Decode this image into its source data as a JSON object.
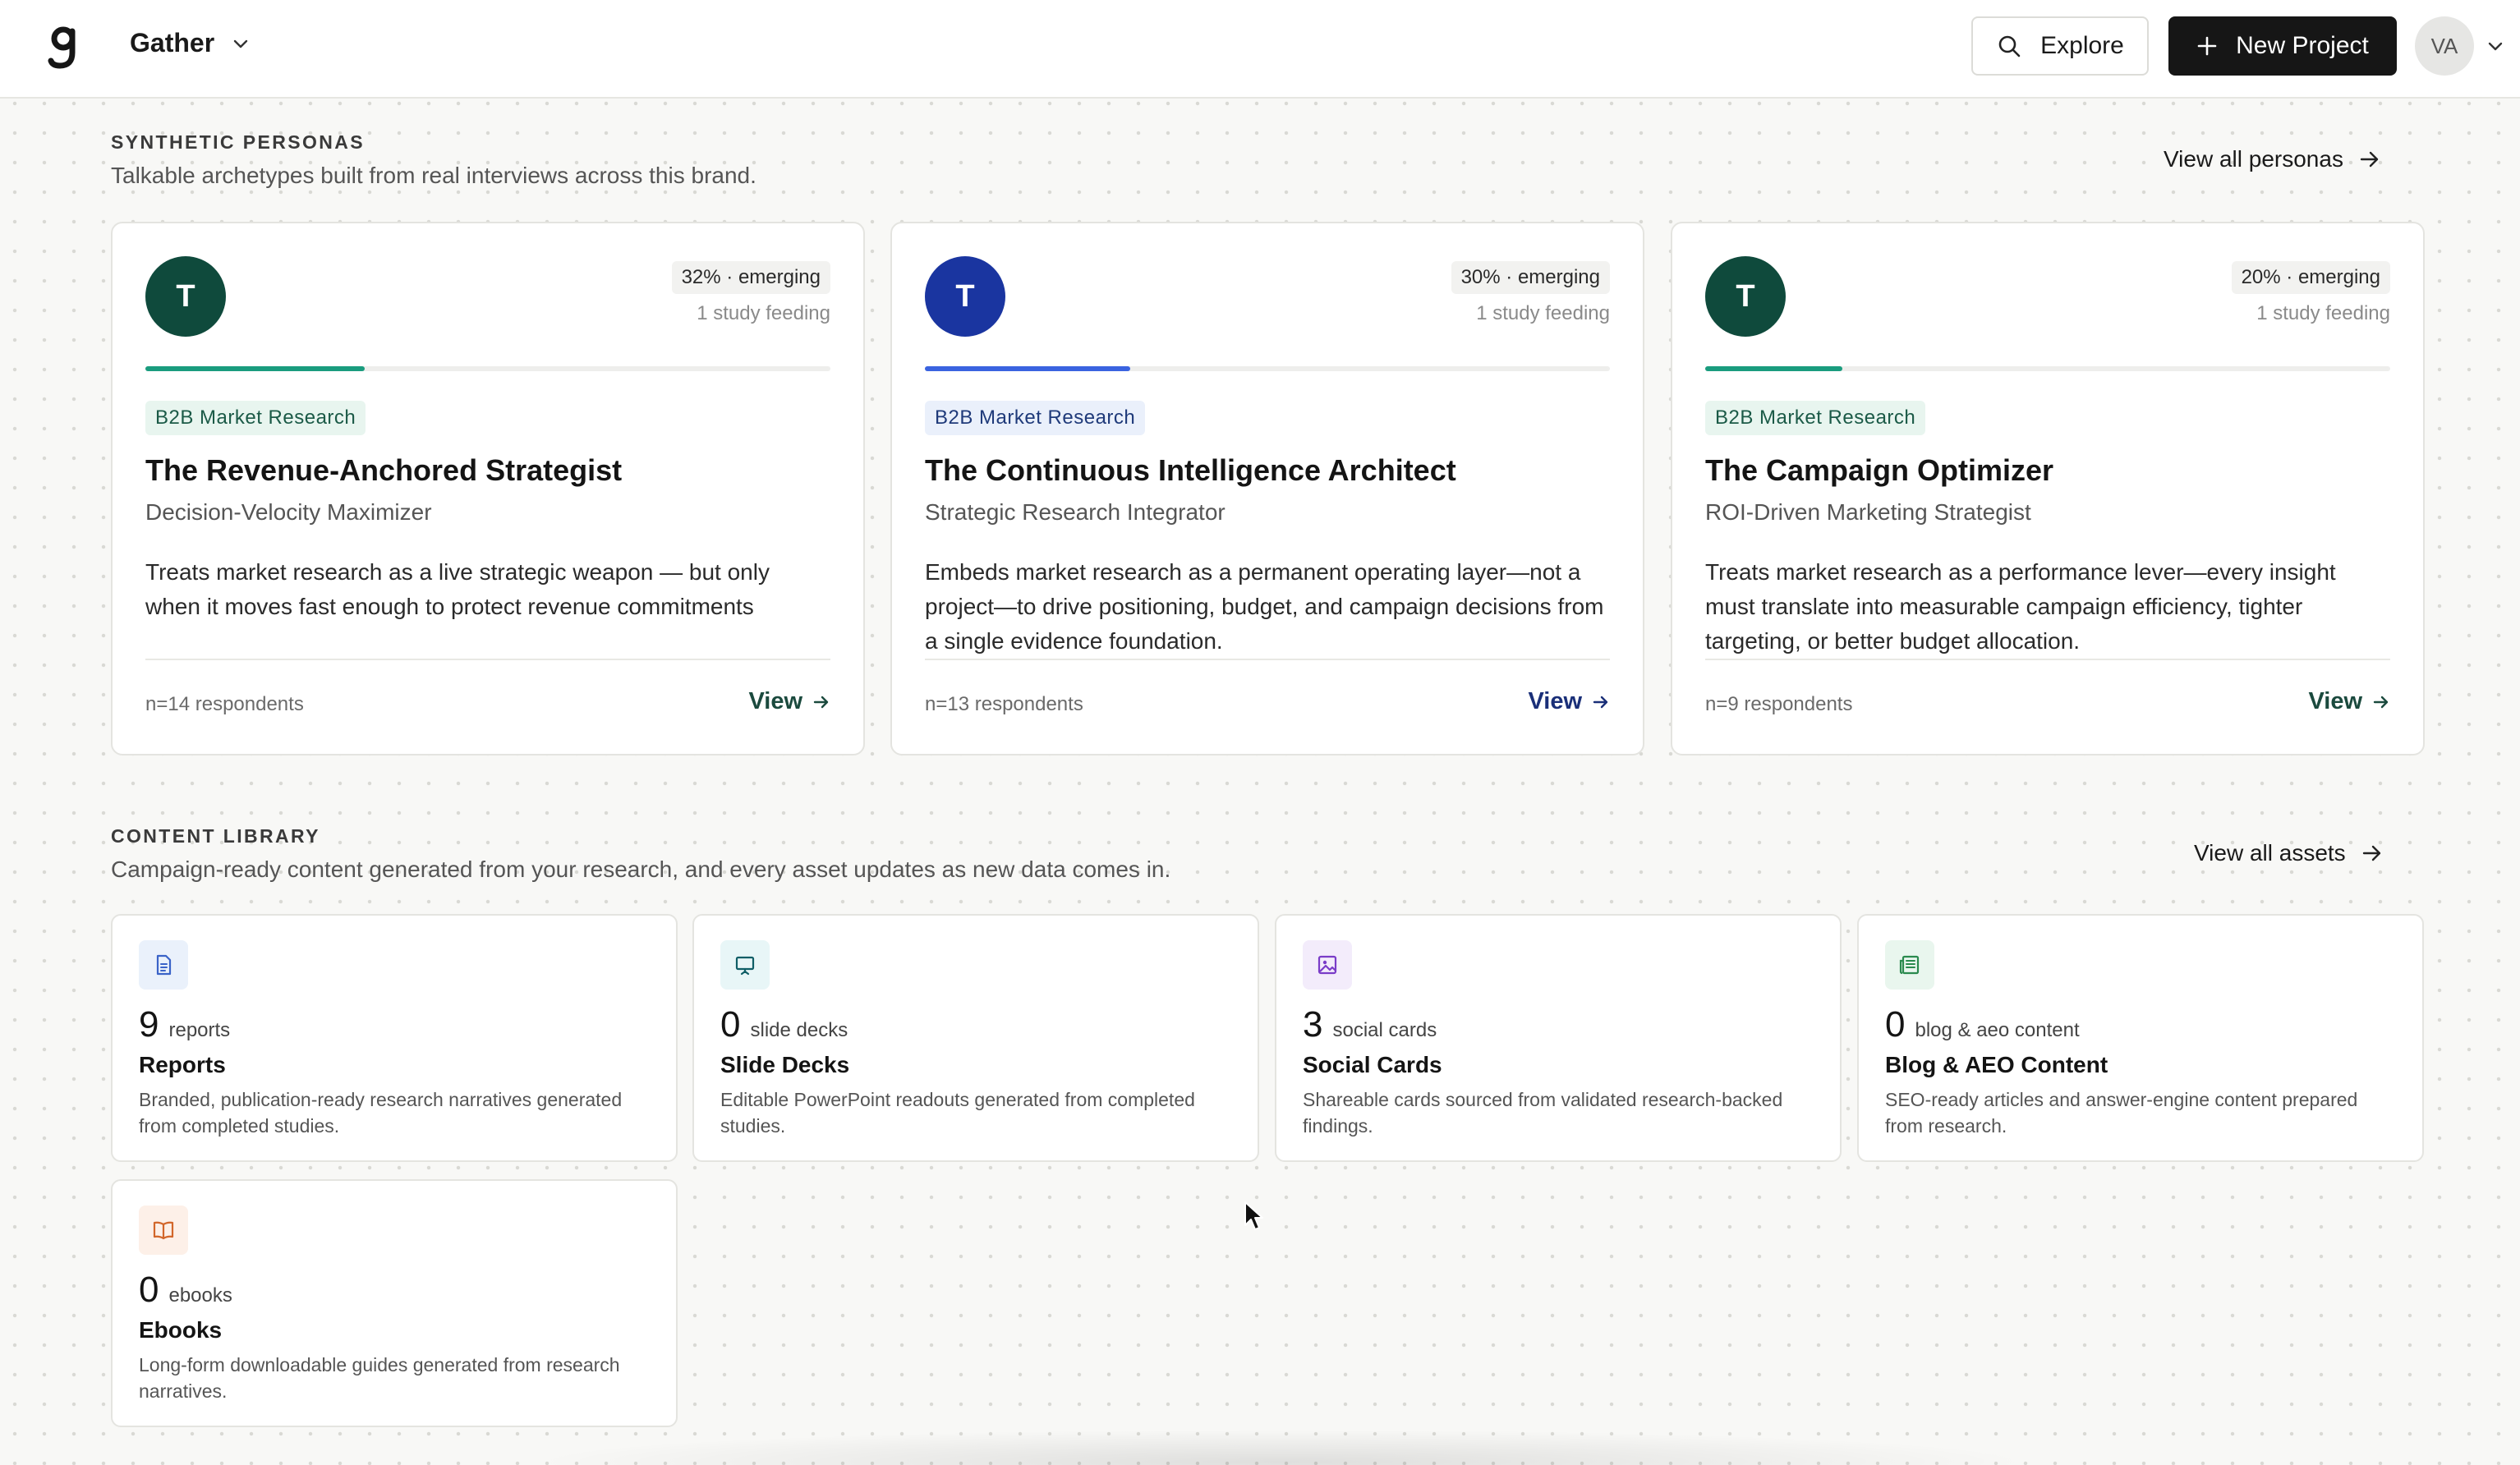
{
  "header": {
    "workspace_name": "Gather",
    "explore_label": "Explore",
    "new_project_label": "New Project",
    "avatar_initials": "VA"
  },
  "personas_section": {
    "title": "SYNTHETIC PERSONAS",
    "subtitle": "Talkable archetypes built from real interviews across this brand.",
    "view_all_label": "View all personas",
    "cards": [
      {
        "initial": "T",
        "avatar_color": "#0f4a3c",
        "badge": "32% · emerging",
        "progress_percent": 32,
        "progress_color": "#1a9c7e",
        "study_text": "1 study feeding",
        "tag": "B2B Market Research",
        "tag_bg": "#e8f5ef",
        "tag_color": "#1b5a47",
        "name": "The Revenue-Anchored Strategist",
        "role": "Decision-Velocity Maximizer",
        "description": "Treats market research as a live strategic weapon — but only when it moves fast enough to protect revenue commitments",
        "respondents": "n=14 respondents",
        "view_label": "View",
        "view_color": "#1b4a3e"
      },
      {
        "initial": "T",
        "avatar_color": "#1a35a0",
        "badge": "30% · emerging",
        "progress_percent": 30,
        "progress_color": "#3a63e0",
        "study_text": "1 study feeding",
        "tag": "B2B Market Research",
        "tag_bg": "#eaf0fb",
        "tag_color": "#1f3a7a",
        "name": "The Continuous Intelligence Architect",
        "role": "Strategic Research Integrator",
        "description": "Embeds market research as a permanent operating layer—not a project—to drive positioning, budget, and campaign decisions from a single evidence foundation.",
        "respondents": "n=13 respondents",
        "view_label": "View",
        "view_color": "#1a2f78"
      },
      {
        "initial": "T",
        "avatar_color": "#0f4a3c",
        "badge": "20% · emerging",
        "progress_percent": 20,
        "progress_color": "#1a9c7e",
        "study_text": "1 study feeding",
        "tag": "B2B Market Research",
        "tag_bg": "#e8f5ef",
        "tag_color": "#1b5a47",
        "name": "The Campaign Optimizer",
        "role": "ROI-Driven Marketing Strategist",
        "description": "Treats market research as a performance lever—every insight must translate into measurable campaign efficiency, tighter targeting, or better budget allocation.",
        "respondents": "n=9 respondents",
        "view_label": "View",
        "view_color": "#1b4a3e"
      }
    ]
  },
  "content_section": {
    "title": "CONTENT LIBRARY",
    "subtitle": "Campaign-ready content generated from your research, and every asset updates as new data comes in.",
    "view_all_label": "View all assets",
    "cards": [
      {
        "icon": "document-icon",
        "icon_bg": "#eaf1fb",
        "icon_color": "#3a63c8",
        "count": "9",
        "unit": "reports",
        "title": "Reports",
        "description": "Branded, publication-ready research narratives generated from completed studies."
      },
      {
        "icon": "presentation-icon",
        "icon_bg": "#e8f6f7",
        "icon_color": "#0f5e66",
        "count": "0",
        "unit": "slide decks",
        "title": "Slide Decks",
        "description": "Editable PowerPoint readouts generated from completed studies."
      },
      {
        "icon": "image-icon",
        "icon_bg": "#f3ecfb",
        "icon_color": "#7a3cc8",
        "count": "3",
        "unit": "social cards",
        "title": "Social Cards",
        "description": "Shareable cards sourced from validated research-backed findings."
      },
      {
        "icon": "newspaper-icon",
        "icon_bg": "#e9f6ee",
        "icon_color": "#2a8a4e",
        "count": "0",
        "unit": "blog & aeo content",
        "title": "Blog & AEO Content",
        "description": "SEO-ready articles and answer-engine content prepared from research."
      },
      {
        "icon": "book-icon",
        "icon_bg": "#fdf0e8",
        "icon_color": "#d2662a",
        "count": "0",
        "unit": "ebooks",
        "title": "Ebooks",
        "description": "Long-form downloadable guides generated from research narratives."
      }
    ]
  }
}
